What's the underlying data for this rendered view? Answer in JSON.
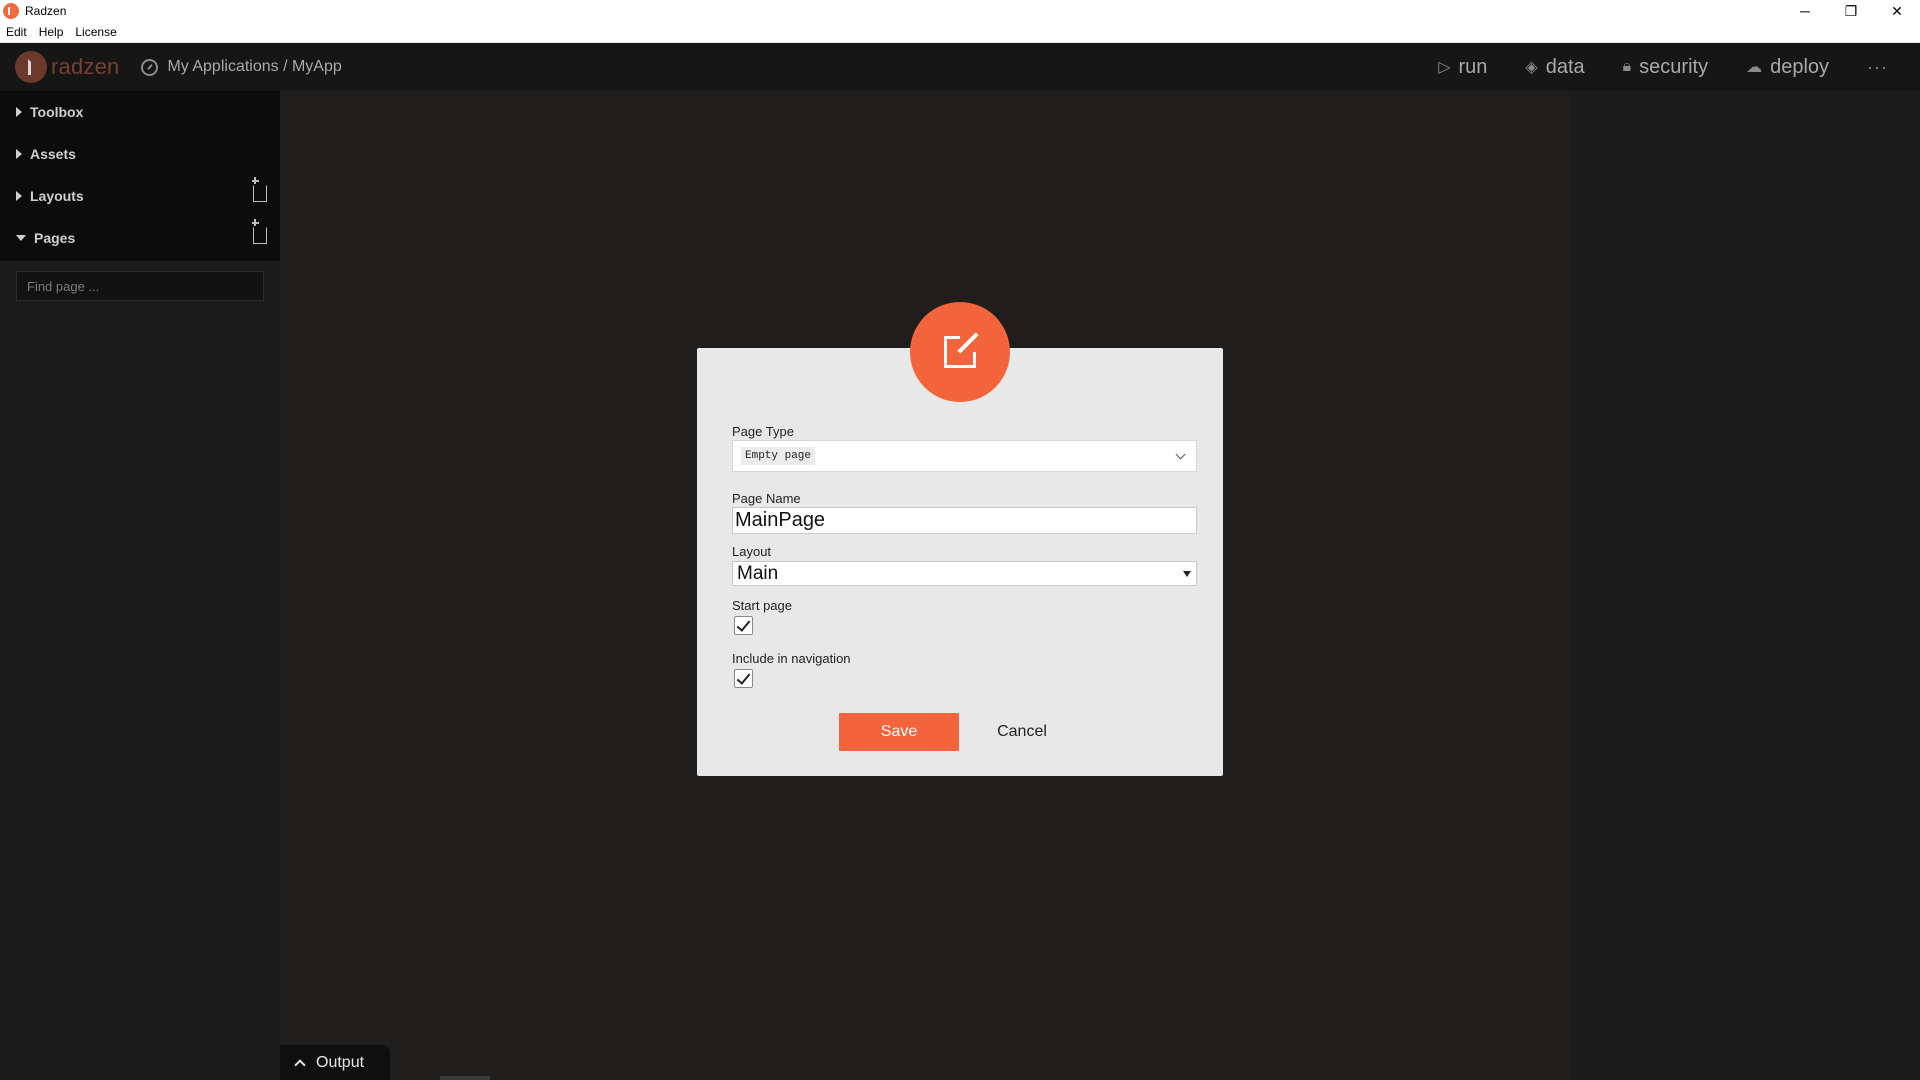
{
  "window": {
    "title": "Radzen",
    "minimize": "─",
    "restore": "❐",
    "close": "✕"
  },
  "menubar": {
    "items": [
      "Edit",
      "Help",
      "License"
    ]
  },
  "header": {
    "logo_text": "radzen",
    "breadcrumb": "My Applications / MyApp",
    "nav": [
      {
        "label": "run",
        "icon": "play-icon",
        "glyph": "▷"
      },
      {
        "label": "data",
        "icon": "layers-icon",
        "glyph": "◈"
      },
      {
        "label": "security",
        "icon": "lock-icon",
        "glyph": "🔒︎"
      },
      {
        "label": "deploy",
        "icon": "cloud-upload-icon",
        "glyph": "☁"
      }
    ],
    "more": "···"
  },
  "sidebar": {
    "items": [
      {
        "label": "Toolbox"
      },
      {
        "label": "Assets"
      },
      {
        "label": "Layouts"
      },
      {
        "label": "Pages"
      }
    ],
    "find_placeholder": "Find page ..."
  },
  "dialog": {
    "page_type_label": "Page Type",
    "page_type_value": "Empty page",
    "page_name_label": "Page Name",
    "page_name_value": "MainPage",
    "layout_label": "Layout",
    "layout_value": "Main",
    "start_page_label": "Start page",
    "start_page_checked": true,
    "include_nav_label": "Include in navigation",
    "include_nav_checked": true,
    "save_label": "Save",
    "cancel_label": "Cancel"
  },
  "output": {
    "label": "Output"
  },
  "colors": {
    "accent": "#f4643c",
    "header_bg": "#161616",
    "canvas_bg": "#201d1d",
    "dialog_bg": "#e8e8e8"
  }
}
